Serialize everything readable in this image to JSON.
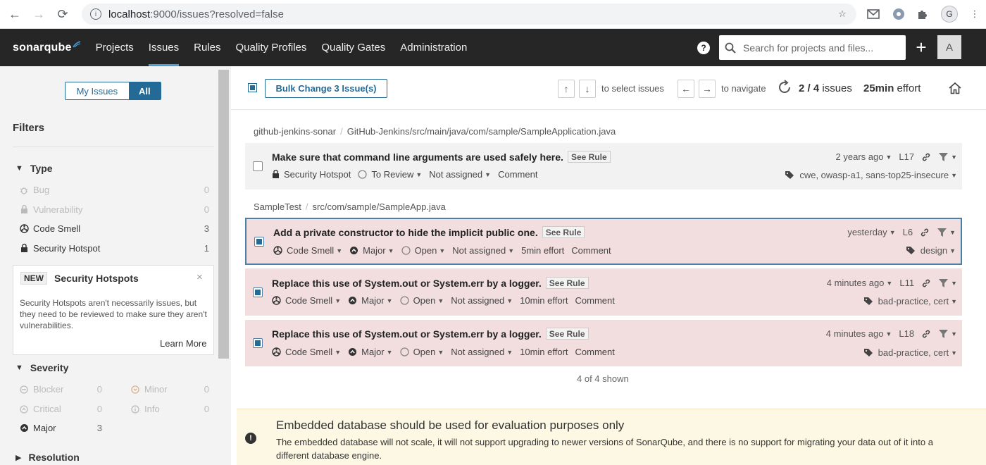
{
  "browser": {
    "url_host": "localhost",
    "url_path": ":9000/issues?resolved=false",
    "profile_initial": "G"
  },
  "nav": {
    "logo": "sonarqube",
    "items": [
      "Projects",
      "Issues",
      "Rules",
      "Quality Profiles",
      "Quality Gates",
      "Administration"
    ],
    "active": "Issues",
    "help": "?",
    "search_placeholder": "Search for projects and files...",
    "plus": "+",
    "avatar": "A"
  },
  "sidebar": {
    "toggle": {
      "my_issues": "My Issues",
      "all": "All"
    },
    "filters_title": "Filters",
    "type": {
      "title": "Type",
      "items": [
        {
          "label": "Bug",
          "count": "0",
          "icon": "bug-icon"
        },
        {
          "label": "Vulnerability",
          "count": "0",
          "icon": "lock-icon"
        },
        {
          "label": "Code Smell",
          "count": "3",
          "icon": "code-smell-icon"
        },
        {
          "label": "Security Hotspot",
          "count": "1",
          "icon": "lock-icon"
        }
      ]
    },
    "new_box": {
      "badge": "NEW",
      "title": "Security Hotspots",
      "close": "×",
      "text": "Security Hotspots aren't necessarily issues, but they need to be reviewed to make sure they aren't vulnerabilities.",
      "learn_more": "Learn More"
    },
    "severity": {
      "title": "Severity",
      "items": [
        {
          "label": "Blocker",
          "count": "0"
        },
        {
          "label": "Minor",
          "count": "0"
        },
        {
          "label": "Critical",
          "count": "0"
        },
        {
          "label": "Info",
          "count": "0"
        },
        {
          "label": "Major",
          "count": "3"
        }
      ]
    },
    "resolution": {
      "title": "Resolution"
    }
  },
  "toolbar": {
    "bulk_change": "Bulk Change 3 Issue(s)",
    "up": "↑",
    "down": "↓",
    "select_hint": "to select issues",
    "left": "←",
    "right": "→",
    "navigate_hint": "to navigate",
    "count_current": "2 / 4",
    "count_label": "issues",
    "effort_value": "25min",
    "effort_label": "effort"
  },
  "groups": [
    {
      "project": "github-jenkins-sonar",
      "path": "GitHub-Jenkins/src/main/java/com/sample/SampleApplication.java"
    },
    {
      "project": "SampleTest",
      "path": "src/com/sample/SampleApp.java"
    }
  ],
  "issues": [
    {
      "title": "Make sure that command line arguments are used safely here.",
      "see_rule": "See Rule",
      "type": "Security Hotspot",
      "status": "To Review",
      "assignee": "Not assigned",
      "comment": "Comment",
      "date": "2 years ago",
      "line": "L17",
      "tags": "cwe, owasp-a1, sans-top25-insecure"
    },
    {
      "title": "Add a private constructor to hide the implicit public one.",
      "see_rule": "See Rule",
      "type": "Code Smell",
      "severity": "Major",
      "status": "Open",
      "assignee": "Not assigned",
      "effort": "5min effort",
      "comment": "Comment",
      "date": "yesterday",
      "line": "L6",
      "tags": "design"
    },
    {
      "title": "Replace this use of System.out or System.err by a logger.",
      "see_rule": "See Rule",
      "type": "Code Smell",
      "severity": "Major",
      "status": "Open",
      "assignee": "Not assigned",
      "effort": "10min effort",
      "comment": "Comment",
      "date": "4 minutes ago",
      "line": "L11",
      "tags": "bad-practice, cert"
    },
    {
      "title": "Replace this use of System.out or System.err by a logger.",
      "see_rule": "See Rule",
      "type": "Code Smell",
      "severity": "Major",
      "status": "Open",
      "assignee": "Not assigned",
      "effort": "10min effort",
      "comment": "Comment",
      "date": "4 minutes ago",
      "line": "L18",
      "tags": "bad-practice, cert"
    }
  ],
  "shown": "4 of 4 shown",
  "banner": {
    "title": "Embedded database should be used for evaluation purposes only",
    "text": "The embedded database will not scale, it will not support upgrading to newer versions of SonarQube, and there is no support for migrating your data out of it into a different database engine."
  },
  "colors": {
    "nav_bg": "#262626",
    "accent": "#236a97",
    "selected_row": "#f2dede",
    "banner": "#fcf8e3"
  }
}
